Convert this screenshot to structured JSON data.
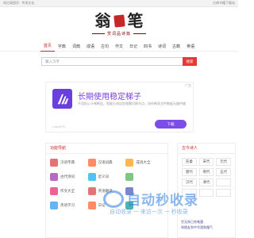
{
  "topbar": {
    "left_text": "知古阁国学 · 传承文化",
    "right_text": "古典书籍下载站"
  },
  "logo": {
    "char_left": "翁",
    "char_right": "笔",
    "slogan": "赏词品诗篇"
  },
  "nav": {
    "items": [
      "首页",
      "字典",
      "词典",
      "成语",
      "古句",
      "作文",
      "日记",
      "四书",
      "诗词",
      "古籍",
      "英语"
    ],
    "active_index": 0
  },
  "search": {
    "placeholder": "输入汉字",
    "button": "搜索"
  },
  "ad": {
    "title": "长期使用稳定梯子",
    "desc": "不用担心卡顿断连，智能分流告别频繁切换节点，协作畅享文件数据无缝传输",
    "brand": "LetsVPN",
    "button": "下载",
    "close": "广告"
  },
  "functions": {
    "heading": "功能导航",
    "items": [
      {
        "label": "汉语字典",
        "color": "#e57373"
      },
      {
        "label": "汉语词典",
        "color": "#ff8a65"
      },
      {
        "label": "成语大全",
        "color": "#ffb74d"
      },
      {
        "label": "古代诗词",
        "color": "#ba68c8"
      },
      {
        "label": "近义词",
        "color": "#4fc3f7"
      },
      {
        "label": "",
        "color": "#81c784"
      },
      {
        "label": "作文大全",
        "color": "#f06292"
      },
      {
        "label": "英语翻译",
        "color": "#e57373"
      },
      {
        "label": "",
        "color": "#7986cb"
      },
      {
        "label": "英语学习",
        "color": "#64b5f6"
      },
      {
        "label": "日记",
        "color": "#ff8a65"
      },
      {
        "label": "",
        "color": "#4db6ac"
      }
    ]
  },
  "dynasties": {
    "heading": "古今诗人",
    "items": [
      "先秦",
      "宋代",
      "元代",
      "唐代",
      "明代",
      "五代",
      "汉代",
      "清代",
      "",
      "",
      "",
      ""
    ]
  },
  "poems": [
    "世无知己终难遇",
    "知朋友到中华酒和霜气"
  ],
  "watermark": {
    "title": "自动秒收录",
    "sub": "自动收录 一 来访一次 一 秒收录"
  }
}
